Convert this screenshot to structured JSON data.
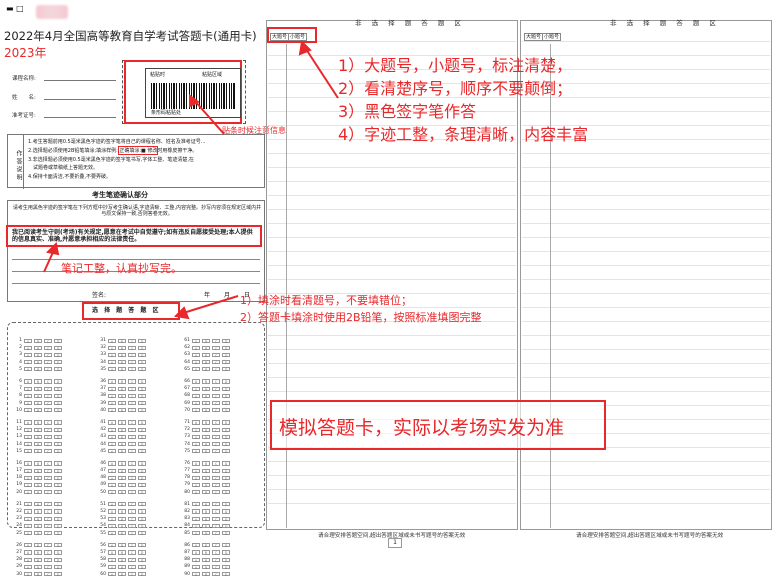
{
  "header": {
    "window_icons": "▬ □",
    "title": "2022年4月全国高等教育自学考试答题卡(通用卡)",
    "year_note": "2023年"
  },
  "info_fields": {
    "course_name": "课程名称:",
    "name": "姓　　名:",
    "exam_id": "准考证号:"
  },
  "barcode": {
    "label_left": "粘贴时",
    "label_right": "粘贴区域",
    "caption": "条形码粘贴处",
    "note": "贴条时候注意信息"
  },
  "notes": {
    "side_label": "作答说明",
    "lines": [
      "1.考生答题前用0.5毫米黑色字迹的签字笔将自己的课程名称、姓名及准考证号...",
      "2.选择题必须使用2B铅笔填涂;填涂样例: 正确填涂:■ 修改时用橡皮擦干净。",
      "3.非选择题必须使用0.5毫米黑色字迹的签字笔书写,字体工整、笔迹清楚,在",
      "　试题卷或草稿纸上答题无效。",
      "4.保持卡面清洁,不要折叠,不要弄破。"
    ]
  },
  "verify": {
    "heading": "考生笔迹确认部分",
    "instruction": "请考生用黑色字迹的签字笔在下列方框中抄写考生确认语,字迹清晰、工整,内容完整。抄写内容须在规定区域内并与原文保持一致,否则答卷无效。",
    "statement": "我已阅读考生守则(考场)有关规定,愿意在考试中自觉遵守;如有违反自愿接受处理;本人提供的信息真实、准确,并愿意承担相应的法律责任。",
    "signature": "签名:",
    "year": "年",
    "month": "月",
    "day": "日"
  },
  "objective": {
    "title": "选 择 题 答 题 区",
    "options": [
      "A",
      "B",
      "C",
      "D"
    ],
    "columns": [
      {
        "groups": [
          [
            1,
            2,
            3,
            4,
            5
          ],
          [
            6,
            7,
            8,
            9,
            10
          ],
          [
            11,
            12,
            13,
            14,
            15
          ],
          [
            16,
            17,
            18,
            19,
            20
          ],
          [
            21,
            22,
            23,
            24,
            25
          ],
          [
            26,
            27,
            28,
            29,
            30
          ]
        ]
      },
      {
        "groups": [
          [
            31,
            32,
            33,
            34,
            35
          ],
          [
            36,
            37,
            38,
            39,
            40
          ],
          [
            41,
            42,
            43,
            44,
            45
          ],
          [
            46,
            47,
            48,
            49,
            50
          ],
          [
            51,
            52,
            53,
            54,
            55
          ],
          [
            56,
            57,
            58,
            59,
            60
          ]
        ]
      },
      {
        "groups": [
          [
            61,
            62,
            63,
            64,
            65
          ],
          [
            66,
            67,
            68,
            69,
            70
          ],
          [
            71,
            72,
            73,
            74,
            75
          ],
          [
            76,
            77,
            78,
            79,
            80
          ],
          [
            81,
            82,
            83,
            84,
            85
          ],
          [
            86,
            87,
            88,
            89,
            90
          ]
        ]
      }
    ]
  },
  "sheets": [
    {
      "title": "非 选 择 题 答 题 区",
      "header_left": "大题号",
      "header_right": "小题号",
      "footer": "请合理安排答题空间,超出答题区域或未书写题号的答案无效"
    },
    {
      "title": "非 选 择 题 答 题 区",
      "header_left": "大题号",
      "header_right": "小题号",
      "footer": "请合理安排答题空间,超出答题区域或未书写题号的答案无效"
    }
  ],
  "page_marker": "1",
  "annotations": {
    "main_list": [
      "1）大题号，小题号，标注清楚，",
      "2）看清楚序号，顺序不要颠倒；",
      "3）黑色签字笔作答",
      "4）字迹工整，条理清晰，内容丰富"
    ],
    "note_copy": "笔记工整，认真抄写完。",
    "fill_list": [
      "1）填涂时看清题号，不要填错位；",
      "2）答题卡填涂时使用2B铅笔，按照标准填图完整"
    ],
    "simulation": "模拟答题卡，实际以考场实发为准"
  },
  "colors": {
    "accent": "#e8282b",
    "rule": "#c8c8c8"
  }
}
